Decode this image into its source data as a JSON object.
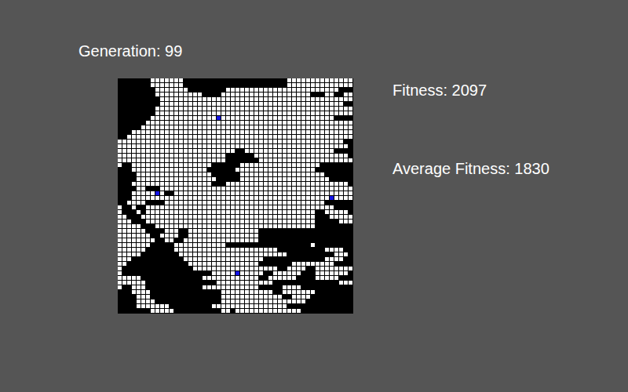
{
  "generation": {
    "label": "Generation: 99"
  },
  "stats": [
    {
      "label": "Fitness: 2097"
    },
    {
      "label": "Average Fitness: 1830"
    }
  ],
  "grid": {
    "legend": {
      ".": "empty",
      "#": "alive",
      "o": "agent"
    },
    "rows": [
      ".......#######......................###############..#######.",
      ".......#######......................#################..######.",
      "........#######........########################...#######",
      "........##########....###################...##..########",
      ".........#############################################.....######",
      ".........#######################################....######",
      "........############################################...#######",
      "........############################################......###",
      ".......##############o########################.......#",
      "......###############################################.......",
      ".....################################################.......",
      "...##################################################......",
      "..###################################################.....",
      "################################################...",
      "#################################################..",
      "#########################..###################.",
      "#######################......####################",
      "#######################.......####################",
      "#..#################......#################.",
      "...################......#################..",
      "....################......##################..",
      "....#################.....###################.",
      "...#################...##########################",
      "....##...###########################################",
      "...#####o#..########################################",
      "...##########################################o########",
      "..####....##################################.......",
      "#..#..########################################.......",
      "#...#.####################################..#####.....",
      "##...#####################################...######....",
      "###...####################################.....######....",
      "#####...##################################.........###...",
      "######....###..###############....................###.",
      "#######..####..###############...........................##",
      "########..##..################.......................",
      "#######.....###########..................#....",
      "######......######################..........####..",
      "#####........#######################..........###..###",
      "###...........#################.............####..#",
      "##.............###############.......#########..",
      "#...............##################..####..##########",
      "#...................#####o#####..######...#######.",
      "#####.............############..######....#####..",
      "######...............############..............###...",
      "#..###............############.....####..........",
      "...####...............###########..#######..........",
      "....###...............#############..####...........",
      "....####..............##################...........",
      "....#######.........################...............",
      ".......#####..........##.##############.............."
    ]
  }
}
